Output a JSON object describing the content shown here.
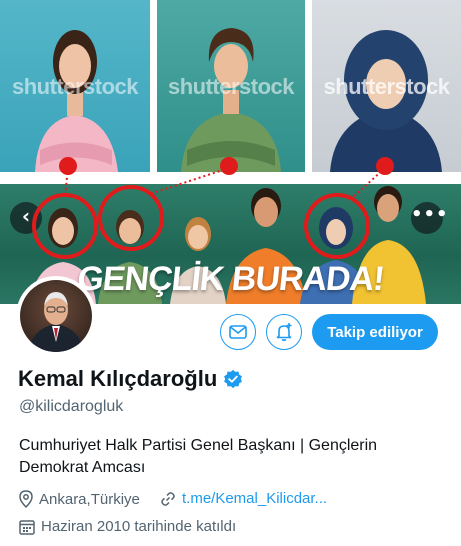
{
  "watermark": "shutterstock",
  "stock_photos": [
    {
      "subject": "smiling-woman-blue-background"
    },
    {
      "subject": "smiling-man-plaid-shirt"
    },
    {
      "subject": "smiling-woman-headscarf"
    }
  ],
  "banner": {
    "title": "GENÇLİK BURADA!",
    "more_icon": "more-icon"
  },
  "profile": {
    "name": "Kemal Kılıçdaroğlu",
    "handle": "@kilicdarogluk",
    "bio": "Cumhuriyet Halk Partisi Genel Başkanı | Gençlerin Demokrat Amcası",
    "location": "Ankara,Türkiye",
    "link": "t.me/Kemal_Kilicdar...",
    "joined": "Haziran 2010 tarihinde katıldı",
    "verified": true
  },
  "actions": {
    "follow_label": "Takip ediliyor",
    "message_icon": "mail-icon",
    "notify_icon": "bell-plus-icon"
  },
  "colors": {
    "accent": "#1d9bf0",
    "annotation": "#e01b1b",
    "banner": "#1f6553"
  }
}
